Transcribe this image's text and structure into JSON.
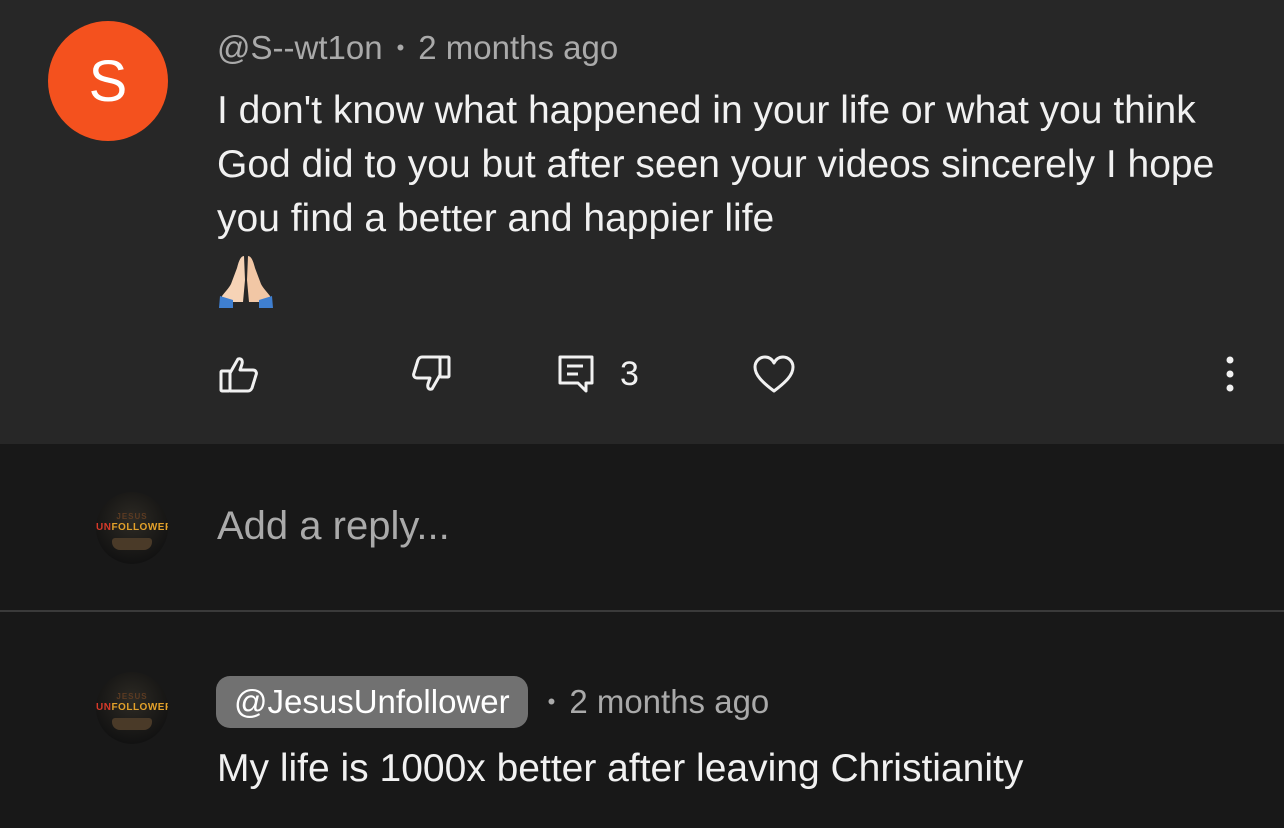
{
  "comment": {
    "avatar_letter": "S",
    "avatar_color": "#f4511e",
    "author": "@S--wt1on",
    "separator": "•",
    "time": "2 months ago",
    "text": "I don't know what happened in your life or what you think God did to you but after seen your videos sincerely I hope you find  a better and happier life",
    "emoji": "folded-hands-emoji",
    "actions": {
      "like_icon": "thumbs-up-icon",
      "dislike_icon": "thumbs-down-icon",
      "reply_icon": "comment-icon",
      "reply_count": "3",
      "heart_icon": "heart-icon",
      "more_icon": "more-vertical-icon"
    }
  },
  "reply_input": {
    "placeholder": "Add a reply...",
    "avatar_top_text": "JESUS",
    "avatar_text_red": "UN",
    "avatar_text_gold": "FOLLOWER"
  },
  "reply": {
    "author": "@JesusUnfollower",
    "separator": "•",
    "time": "2 months ago",
    "text": "My life is 1000x better after leaving Christianity",
    "avatar_top_text": "JESUS",
    "avatar_text_red": "UN",
    "avatar_text_gold": "FOLLOWER"
  },
  "colors": {
    "top_background": "#272727",
    "page_background": "#181818",
    "author_chip": "#717171",
    "secondary_text": "#aaaaaa"
  }
}
